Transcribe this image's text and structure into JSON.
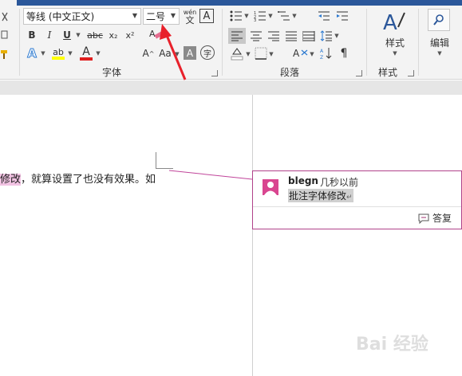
{
  "ribbon": {
    "font_name": "等线 (中文正文)",
    "font_size": "二号",
    "phonetic_label_top": "wén",
    "phonetic_label_bottom": "文",
    "bold": "B",
    "italic": "I",
    "underline": "U",
    "strikethrough": "abc",
    "subscript": "x₂",
    "superscript": "x²",
    "text_effects": "A",
    "highlight": "ab",
    "font_color": "A",
    "grow_font": "A",
    "change_case": "Aa",
    "char_shading": "A",
    "enclose_char": "字",
    "group_font": "字体",
    "group_paragraph": "段落",
    "group_styles": "样式",
    "styles_button": "样式",
    "edit_button": "编辑"
  },
  "document": {
    "highlighted_text": "修改",
    "body_text": "，就算设置了也没有效果。如"
  },
  "comment": {
    "author": "blegn",
    "time": "几秒以前",
    "text": "批注字体修改",
    "reply_label": "答复"
  },
  "watermark": "Bai 经验",
  "colors": {
    "title_bar": "#2b579a",
    "ribbon_bg": "#f3f3f3",
    "comment_border": "#b0428a",
    "avatar": "#d94690",
    "highlight": "#f2c3e3",
    "arrow": "#e8212b"
  }
}
